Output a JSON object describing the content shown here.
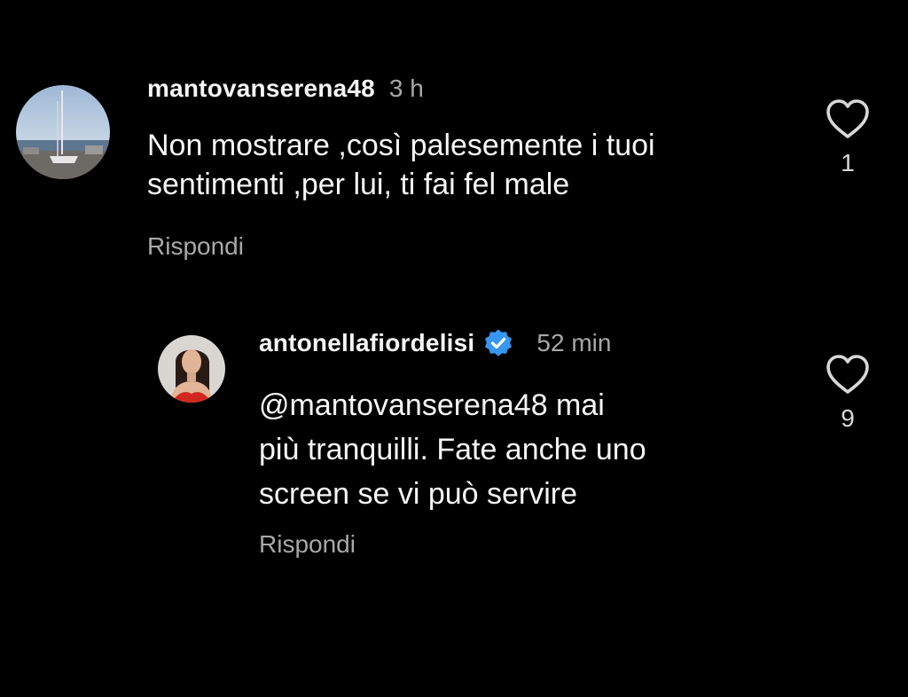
{
  "comments": [
    {
      "username": "mantovanserena48",
      "time": "3 h",
      "verified": false,
      "text_lines": [
        "Non mostrare ,così palesemente i tuoi",
        "sentimenti ,per lui, ti fai fel male"
      ],
      "reply_label": "Rispondi",
      "likes": "1"
    },
    {
      "username": "antonellafiordelisi",
      "time": "52 min",
      "verified": true,
      "text_lines": [
        "@mantovanserena48 mai",
        "più tranquilli. Fate anche uno",
        "screen se vi può servire"
      ],
      "reply_label": "Rispondi",
      "likes": "9"
    }
  ],
  "icons": {
    "like": "heart-outline-icon",
    "verified": "verified-badge-icon"
  },
  "colors": {
    "background": "#000000",
    "text": "#f5f5f5",
    "muted": "#a8a8a8",
    "verified": "#3797f0"
  }
}
